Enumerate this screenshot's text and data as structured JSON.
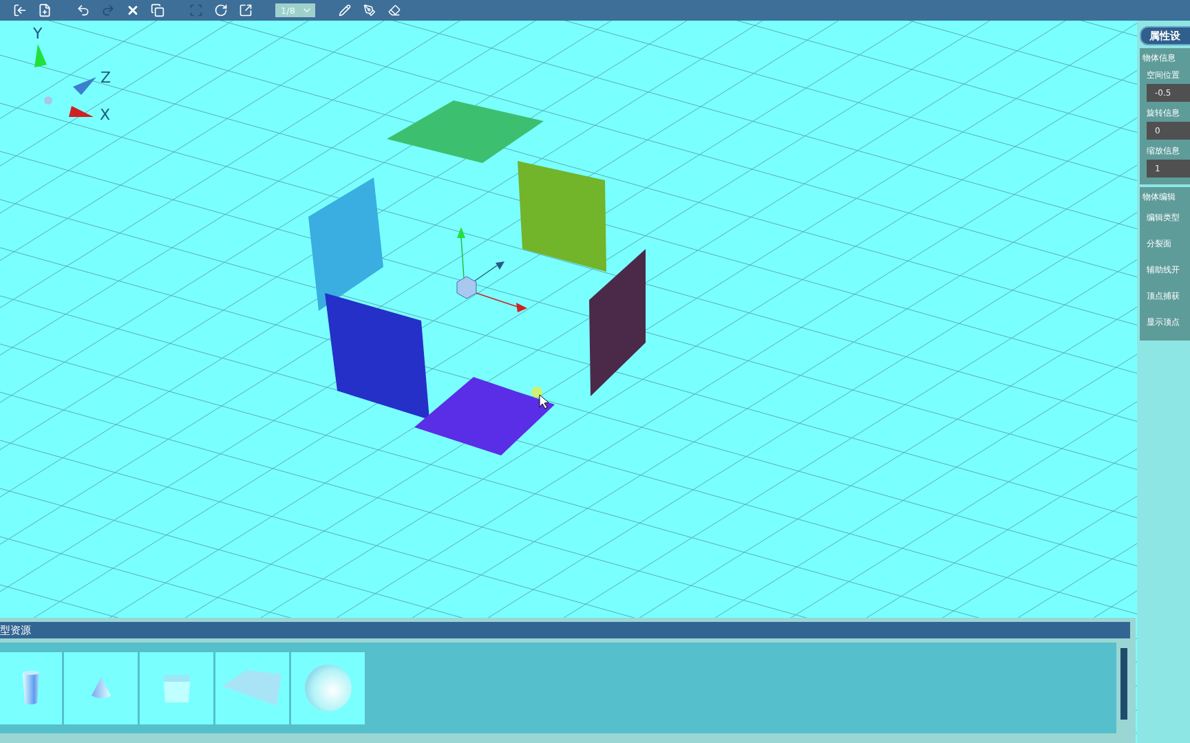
{
  "toolbar": {
    "page_select": "1/8"
  },
  "scene": {
    "axis_labels": [
      "Y",
      "Z",
      "X"
    ]
  },
  "properties_panel": {
    "title": "属性设",
    "object_info": {
      "heading": "物体信息",
      "fields": [
        {
          "label": "空间位置",
          "value": "-0.5"
        },
        {
          "label": "旋转信息",
          "value": "0"
        },
        {
          "label": "缩放信息",
          "value": "1"
        }
      ]
    },
    "object_edit": {
      "heading": "物体编辑",
      "items": [
        "编辑类型",
        "分裂面",
        "辅助线开",
        "顶点捕获",
        "显示顶点"
      ]
    }
  },
  "model_resources": {
    "title": "型资源",
    "items": [
      {
        "kind": "cylinder"
      },
      {
        "kind": "cone"
      },
      {
        "kind": "cube"
      },
      {
        "kind": "plane"
      },
      {
        "kind": "sphere"
      }
    ]
  }
}
